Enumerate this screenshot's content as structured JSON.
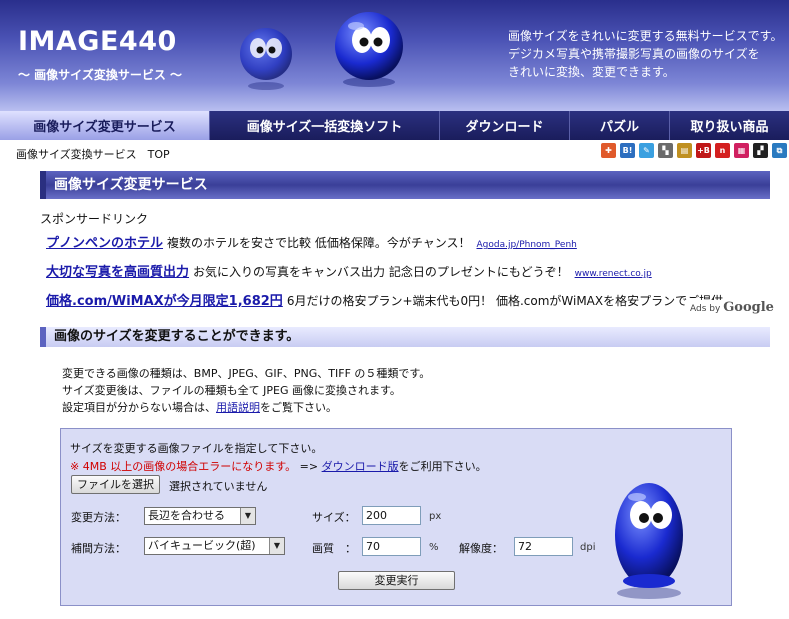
{
  "header": {
    "brand": "IMAGE440",
    "tagline": "～ 画像サイズ変換サービス ～",
    "description": [
      "画像サイズをきれいに変更する無料サービスです。",
      "デジカメ写真や携帯撮影写真の画像のサイズを",
      "きれいに変換、変更できます。"
    ]
  },
  "nav": {
    "items": [
      {
        "label": "画像サイズ変更サービス"
      },
      {
        "label": "画像サイズ一括変換ソフト"
      },
      {
        "label": "ダウンロード"
      },
      {
        "label": "パズル"
      },
      {
        "label": "取り扱い商品"
      }
    ]
  },
  "breadcrumb": "画像サイズ変換サービス　TOP",
  "social": [
    {
      "icon": "bookmark-icon",
      "text": "✚",
      "color": "#e05a2b"
    },
    {
      "icon": "hatena-bookmark-icon",
      "text": "B!",
      "color": "#2c6ebf"
    },
    {
      "icon": "edit-icon",
      "text": "✎",
      "color": "#3aa0e0"
    },
    {
      "icon": "delicious-icon",
      "text": "▚",
      "color": "#6b6b6b"
    },
    {
      "icon": "clip-icon",
      "text": "▤",
      "color": "#c09020"
    },
    {
      "icon": "add-bookmark-icon",
      "text": "+B",
      "color": "#c01818"
    },
    {
      "icon": "n-icon",
      "text": "n",
      "color": "#d42020"
    },
    {
      "icon": "livedoor-icon",
      "text": "▦",
      "color": "#d02060"
    },
    {
      "icon": "square-icon",
      "text": "▞",
      "color": "#222222"
    },
    {
      "icon": "share-icon",
      "text": "⧉",
      "color": "#2a7ac0"
    }
  ],
  "section1": {
    "title": "画像サイズ変更サービス"
  },
  "ads": {
    "sponsor_label": "スポンサードリンク",
    "items": [
      {
        "title": "プノンペンのホテル",
        "text": "複数のホテルを安さで比較 低価格保障。今がチャンス！",
        "url": "Agoda.jp/Phnom_Penh"
      },
      {
        "title": "大切な写真を高画質出力",
        "text": "お気に入りの写真をキャンバス出力 記念日のプレゼントにもどうぞ！",
        "url": "www.renect.co.jp"
      },
      {
        "title": "価格.com/WiMAXが今月限定1,682円",
        "text": "6月だけの格安プラン+端末代も0円！ 価格.comがWiMAXを格安プランでご提供",
        "url": ""
      }
    ],
    "ads_by": "Ads by",
    "google": "Google"
  },
  "section2": {
    "title": "画像のサイズを変更することができます。"
  },
  "intro": {
    "line1": "変更できる画像の種類は、BMP、JPEG、GIF、PNG、TIFF の５種類です。",
    "line2": "サイズ変更後は、ファイルの種類も全て JPEG 画像に変換されます。",
    "line3_pre": "設定項目が分からない場合は、",
    "line3_link": "用語説明",
    "line3_post": "をご覧下さい。"
  },
  "form": {
    "instruction": "サイズを変更する画像ファイルを指定して下さい。",
    "warning": "※ 4MB 以上の画像の場合エラーになります。",
    "arrow": "=>",
    "download_link": "ダウンロード版",
    "download_post": "をご利用下さい。",
    "file_button": "ファイルを選択",
    "file_status": "選択されていません",
    "method_label": "変更方法：",
    "method_value": "長辺を合わせる",
    "interp_label": "補間方法：",
    "interp_value": "バイキュービック(超)",
    "size_label": "サイズ：",
    "size_value": "200",
    "size_unit": "px",
    "quality_label": "画質　：",
    "quality_value": "70",
    "quality_unit": "%",
    "resolution_label": "解像度：",
    "resolution_value": "72",
    "resolution_unit": "dpi",
    "submit": "変更実行"
  }
}
